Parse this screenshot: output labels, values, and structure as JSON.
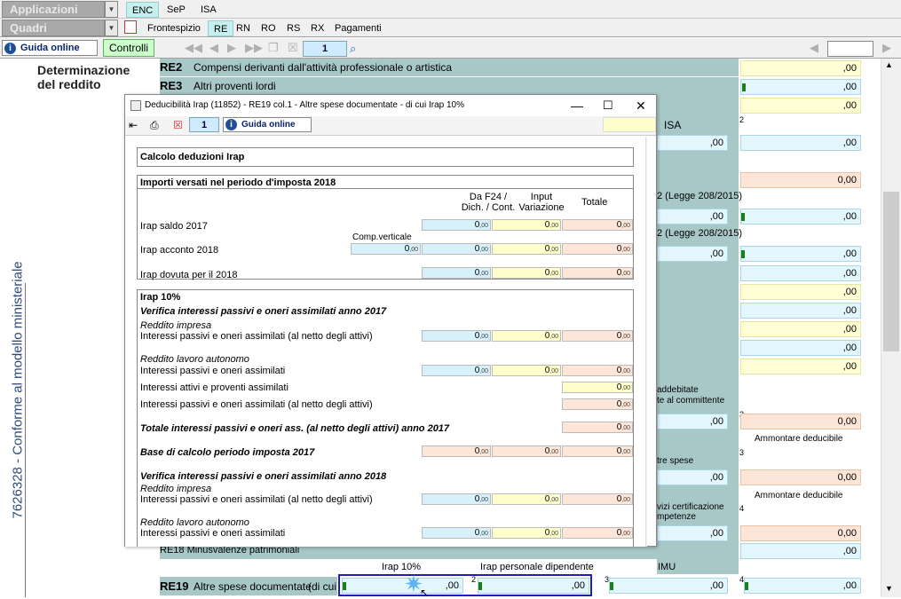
{
  "top": {
    "combo1": "Applicazioni",
    "combo2": "Quadri",
    "tabs_row1": [
      "ENC",
      "SeP",
      "ISA"
    ],
    "tabs_row2": [
      "Frontespizio",
      "RE",
      "RN",
      "RO",
      "RS",
      "RX",
      "Pagamenti"
    ],
    "guide_btn": "Guida online",
    "controls_btn": "Controlli",
    "page": "1"
  },
  "sidebar": {
    "vertical_text": "7626328 - Conforme al modello ministeriale"
  },
  "form": {
    "section_title_1": "Determinazione",
    "section_title_2": "del reddito",
    "rows": [
      {
        "code": "RE2",
        "label": "Compensi derivanti dall'attività professionale o artistica",
        "value": ",00"
      },
      {
        "code": "RE3",
        "label": "Altri proventi lordi",
        "value": ",00"
      }
    ],
    "isa_label": "ISA",
    "col2": "2",
    "legge1": "2 (Legge 208/2015)",
    "legge2": "2 (Legge 208/2015)",
    "addebitate_1": "addebitate",
    "addebitate_2": "te al committente",
    "ammontare1": "Ammontare deducibile",
    "ammontare2": "Ammontare deducibile",
    "tre_spese": "tre spese",
    "servizi_1": "vizi certificazione",
    "servizi_2": "mpetenze",
    "re18_label": "RE18  Minusvalenze patrimoniali",
    "re19_code": "RE19",
    "re19_label": "Altre spese documentate",
    "re19_dicui": "(di cui",
    "re19_h1": "Irap 10%",
    "re19_h2": "Irap personale dipendente",
    "re19_h3": "IMU",
    "num3": "3",
    "num4": "4",
    "zero_dec": ",00",
    "zero_full": "0,00"
  },
  "dialog": {
    "title": "Deducibilità Irap (11852) - RE19 col.1 - Altre spese documentate - di cui Irap 10%",
    "page": "1",
    "guide": "Guida online",
    "calc_title": "Calcolo deduzioni Irap",
    "imp_title": "Importi versati nel periodo d'imposta 2018",
    "col_h1a": "Da F24 /",
    "col_h1b": "Dich. / Cont.",
    "col_h2a": "Input",
    "col_h2b": "Variazione",
    "col_h3": "Totale",
    "comp_vert": "Comp.verticale",
    "rows_a": [
      "Irap saldo 2017",
      "Irap acconto 2018",
      "Irap dovuta per il 2018"
    ],
    "irap10": "Irap 10%",
    "ver2017": "Verifica interessi passivi e oneri assimilati anno 2017",
    "reddito_impresa": "Reddito impresa",
    "int_netto": "Interessi passivi e oneri assimilati (al netto degli attivi)",
    "reddito_lav": "Reddito lavoro autonomo",
    "int_pass": "Interessi passivi e oneri assimilati",
    "int_att": "Interessi attivi e proventi assimilati",
    "tot_2017": "Totale interessi passivi e oneri ass. (al netto degli attivi) anno 2017",
    "base_2017": "Base di calcolo periodo imposta 2017",
    "ver2018": "Verifica interessi passivi e oneri assimilati anno 2018",
    "zero": "0",
    "dec": ",00"
  }
}
